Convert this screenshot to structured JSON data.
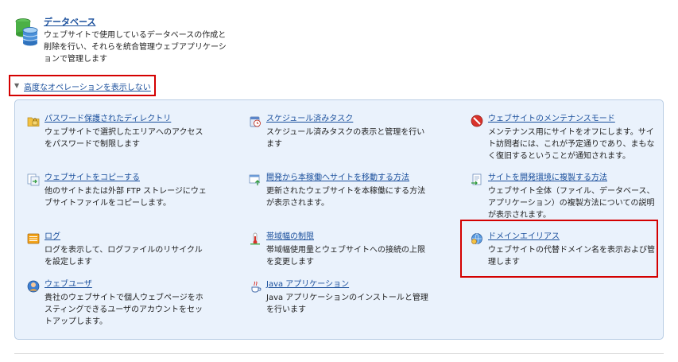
{
  "database": {
    "icon": "database-icon",
    "title": "データベース",
    "description": "ウェブサイトで使用しているデータベースの作成と削除を行い、それらを統合管理ウェブアプリケーションで管理します"
  },
  "advanced_toggle": {
    "icon": "triangle-down-icon",
    "label": "高度なオペレーションを表示しない"
  },
  "items": [
    {
      "icon": "password-folder-icon",
      "title": "パスワード保護されたディレクトリ",
      "description": "ウェブサイトで選択したエリアへのアクセスをパスワードで制限します"
    },
    {
      "icon": "scheduled-task-icon",
      "title": "スケジュール済みタスク",
      "description": "スケジュール済みタスクの表示と管理を行います"
    },
    {
      "icon": "maintenance-icon",
      "title": "ウェブサイトのメンテナンスモード",
      "description": "メンテナンス用にサイトをオフにします。サイト訪問者には、これが予定通りであり、まもなく復旧するということが通知されます。"
    },
    {
      "icon": "copy-site-icon",
      "title": "ウェブサイトをコピーする",
      "description": "他のサイトまたは外部 FTP ストレージにウェブサイトファイルをコピーします。"
    },
    {
      "icon": "move-to-production-icon",
      "title": "開発から本稼働へサイトを移動する方法",
      "description": "更新されたウェブサイトを本稼働にする方法が表示されます。"
    },
    {
      "icon": "copy-to-dev-icon",
      "title": "サイトを開発環境に複製する方法",
      "description": "ウェブサイト全体（ファイル、データベース、アプリケーション）の複製方法についての説明が表示されます。"
    },
    {
      "icon": "log-icon",
      "title": "ログ",
      "description": "ログを表示して、ログファイルのリサイクルを設定します"
    },
    {
      "icon": "bandwidth-icon",
      "title": "帯域幅の制限",
      "description": "帯域幅使用量とウェブサイトへの接続の上限を変更します"
    },
    {
      "icon": "domain-alias-icon",
      "title": "ドメインエイリアス",
      "description": "ウェブサイトの代替ドメイン名を表示および管理します"
    },
    {
      "icon": "web-user-icon",
      "title": "ウェブユーザ",
      "description": "貴社のウェブサイトで個人ウェブページをホスティングできるユーザのアカウントをセットアップします。"
    },
    {
      "icon": "java-icon",
      "title": "Java アプリケーション",
      "description": "Java アプリケーションのインストールと管理を行います"
    }
  ]
}
